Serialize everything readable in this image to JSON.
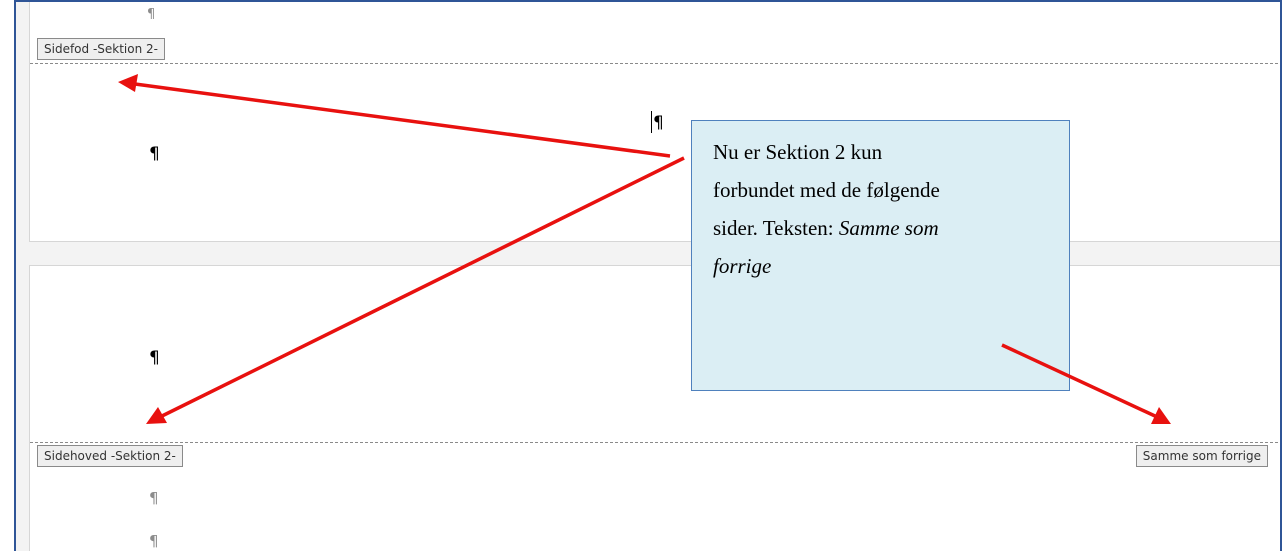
{
  "upper_page": {
    "footer_tag": "Sidefod -Sektion 2-"
  },
  "lower_page": {
    "header_tag": "Sidehoved -Sektion 2-",
    "same_as_previous_tag": "Samme som forrige"
  },
  "formatting_marks": {
    "paragraph_mark": "¶"
  },
  "callout": {
    "line1": "Nu er Sektion 2 kun",
    "line2": "forbundet med de følgende",
    "line3_prefix": "sider. Teksten: ",
    "line3_italic": "Samme som",
    "line4_italic": "forrige"
  },
  "colors": {
    "arrow": "#e8110f",
    "callout_fill": "#dbeef4",
    "callout_border": "#4f81bd",
    "window_border": "#2f5597"
  }
}
